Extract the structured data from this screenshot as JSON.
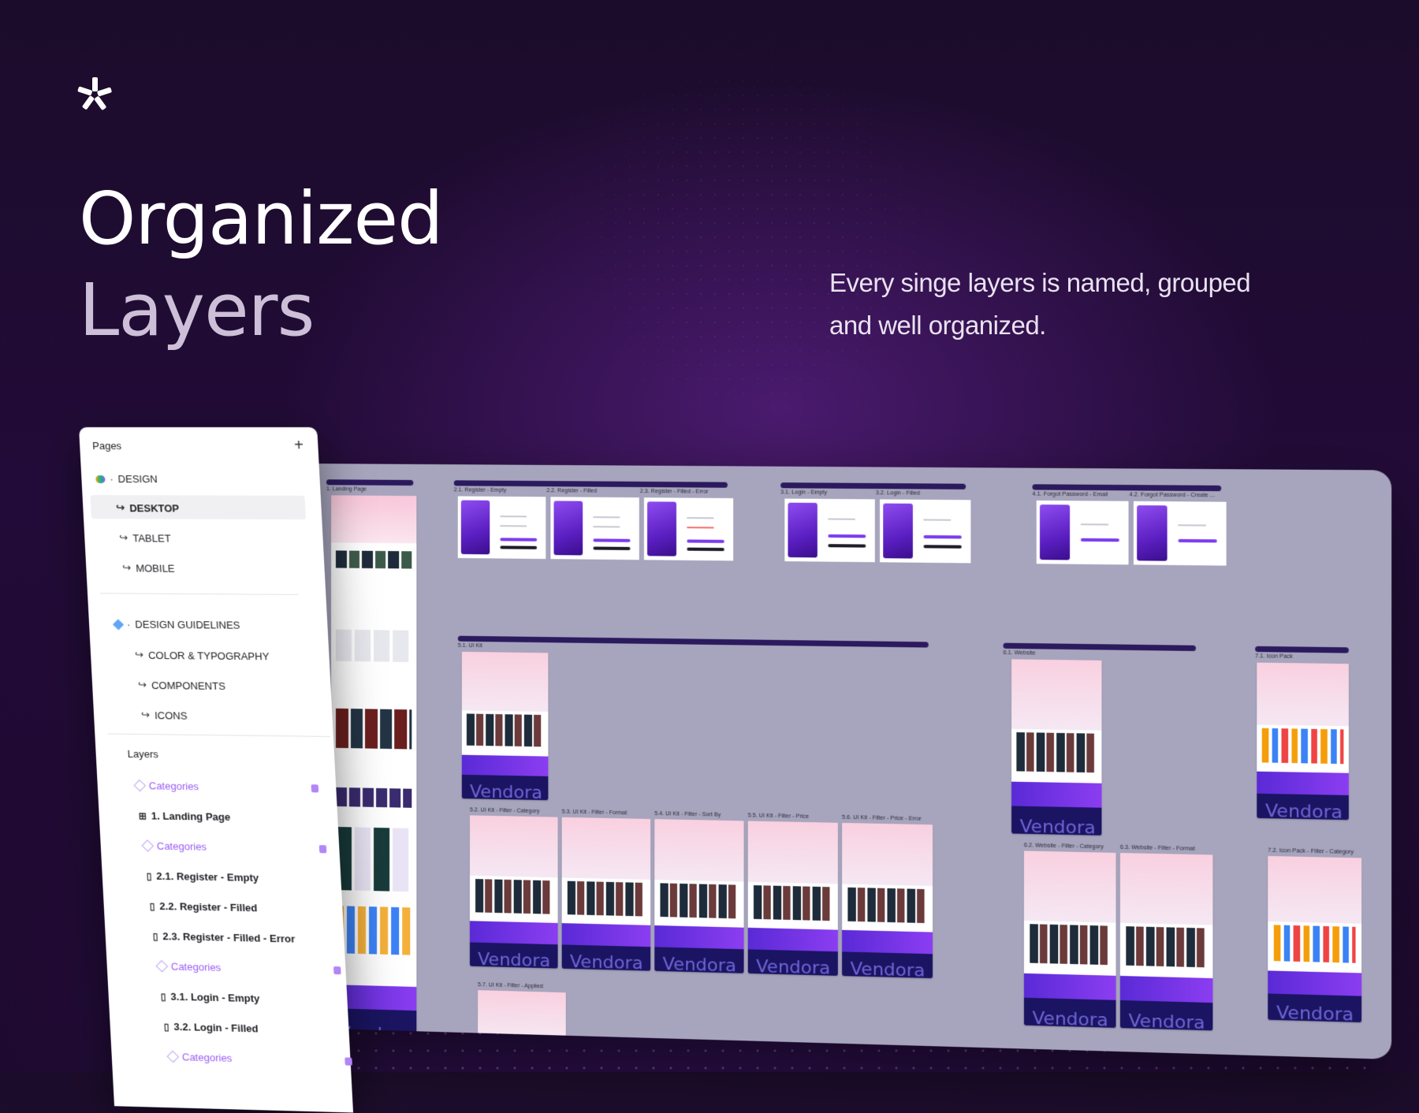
{
  "hero": {
    "title_line1": "Organized",
    "title_line2": "Layers",
    "subtitle": "Every singe layers is named, grouped and well organized."
  },
  "panel": {
    "pages_header": "Pages",
    "add_icon": "plus-icon",
    "pages": [
      {
        "label": "DESIGN",
        "kind": "group"
      },
      {
        "label": "DESKTOP",
        "kind": "page",
        "selected": true
      },
      {
        "label": "TABLET",
        "kind": "page"
      },
      {
        "label": "MOBILE",
        "kind": "page"
      },
      {
        "label": "DESIGN GUIDELINES",
        "kind": "group"
      },
      {
        "label": "COLOR & TYPOGRAPHY",
        "kind": "page"
      },
      {
        "label": "COMPONENTS",
        "kind": "page"
      },
      {
        "label": "ICONS",
        "kind": "page"
      }
    ],
    "layers_header": "Layers",
    "layers": [
      {
        "label": "Categories",
        "kind": "component",
        "locked": true
      },
      {
        "label": "1. Landing Page",
        "kind": "frame"
      },
      {
        "label": "Categories",
        "kind": "component",
        "locked": true
      },
      {
        "label": "2.1. Register - Empty",
        "kind": "frame"
      },
      {
        "label": "2.2. Register - Filled",
        "kind": "frame"
      },
      {
        "label": "2.3. Register - Filled - Error",
        "kind": "frame"
      },
      {
        "label": "Categories",
        "kind": "component",
        "locked": true
      },
      {
        "label": "3.1. Login - Empty",
        "kind": "frame"
      },
      {
        "label": "3.2. Login - Filled",
        "kind": "frame"
      },
      {
        "label": "Categories",
        "kind": "component",
        "locked": true
      }
    ]
  },
  "canvas": {
    "frame_labels": {
      "landing": "1. Landing Page",
      "reg1": "2.1. Register - Empty",
      "reg2": "2.2. Register - Filled",
      "reg3": "2.3. Register - Filled - Error",
      "login1": "3.1. Login - Empty",
      "login2": "3.2. Login - Filled",
      "forgot1": "4.1. Forgot Password - Email",
      "forgot2": "4.2. Forgot Password - Create ...",
      "uikit": "5.1. UI Kit",
      "uikit2": "5.2. UI Kit - Filter - Category",
      "uikit3": "5.3. UI Kit - Filter - Format",
      "uikit4": "5.4. UI Kit - Filter - Sort By",
      "uikit5": "5.5. UI Kit - Filter - Price",
      "uikit6": "5.6. UI Kit - Filter - Price - Error",
      "uikit7": "5.7. UI Kit - Filter - Applied",
      "web1": "6.1. Website",
      "web2": "6.2. Website - Filter - Category",
      "web3": "6.3. Website - Filter - Format",
      "icon1": "7.1. Icon Pack",
      "icon2": "7.2. Icon Pack - Filter - Category"
    },
    "footer_brand": "Vendora"
  },
  "colors": {
    "accent": "#9b5cf6",
    "canvas_bg": "#a7a5bd",
    "group_bar": "#2b1a5e"
  }
}
